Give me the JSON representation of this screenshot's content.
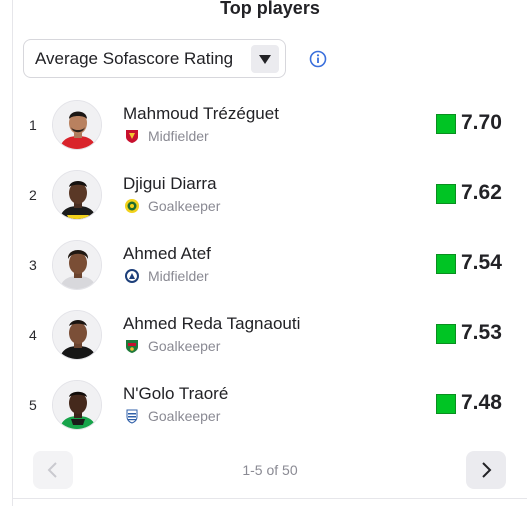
{
  "title": "Top players",
  "metric_select": {
    "value": "Average Sofascore Rating"
  },
  "rating_color": "#00c424",
  "players": [
    {
      "rank": "1",
      "name": "Mahmoud Trézéguet",
      "position": "Midfielder",
      "rating": "7.70",
      "team_icon": "al-ahly-crest-icon"
    },
    {
      "rank": "2",
      "name": "Djigui Diarra",
      "position": "Goalkeeper",
      "rating": "7.62",
      "team_icon": "young-africans-crest-icon"
    },
    {
      "rank": "3",
      "name": "Ahmed Atef",
      "position": "Midfielder",
      "rating": "7.54",
      "team_icon": "pyramids-crest-icon"
    },
    {
      "rank": "4",
      "name": "Ahmed Reda Tagnaouti",
      "position": "Goalkeeper",
      "rating": "7.53",
      "team_icon": "as-far-crest-icon"
    },
    {
      "rank": "5",
      "name": "N'Golo Traoré",
      "position": "Goalkeeper",
      "rating": "7.48",
      "team_icon": "club-crest-icon"
    }
  ],
  "pagination": {
    "label": "1-5 of 50"
  }
}
